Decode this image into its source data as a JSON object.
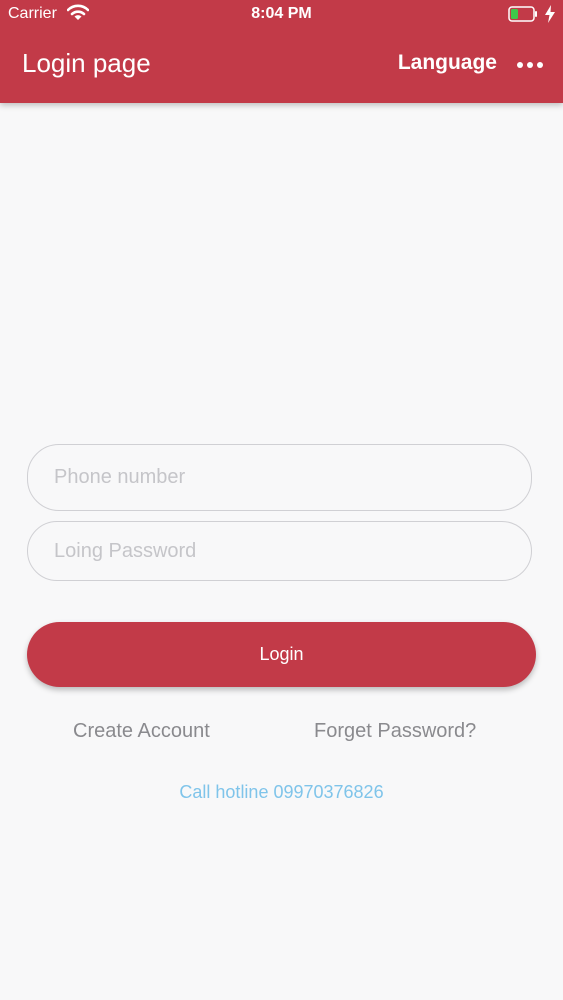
{
  "status_bar": {
    "carrier": "Carrier",
    "time": "8:04 PM",
    "wifi_icon": "wifi-icon",
    "battery_icon": "battery-icon",
    "charging_icon": "charging-bolt-icon"
  },
  "app_bar": {
    "title": "Login page",
    "language_label": "Language",
    "more_icon": "more-horizontal-icon",
    "background_color": "#c23a48"
  },
  "form": {
    "phone": {
      "placeholder": "Phone number",
      "value": ""
    },
    "password": {
      "placeholder": "Loing Password",
      "value": ""
    },
    "login_label": "Login",
    "create_account_label": "Create Account",
    "forget_password_label": "Forget Password?",
    "hotline_label": "Call hotline 09970376826"
  },
  "colors": {
    "accent": "#c23a48",
    "hotline": "#7fc4ea",
    "secondary_text": "#8a8a8e",
    "battery_level": "#3ec84a"
  }
}
